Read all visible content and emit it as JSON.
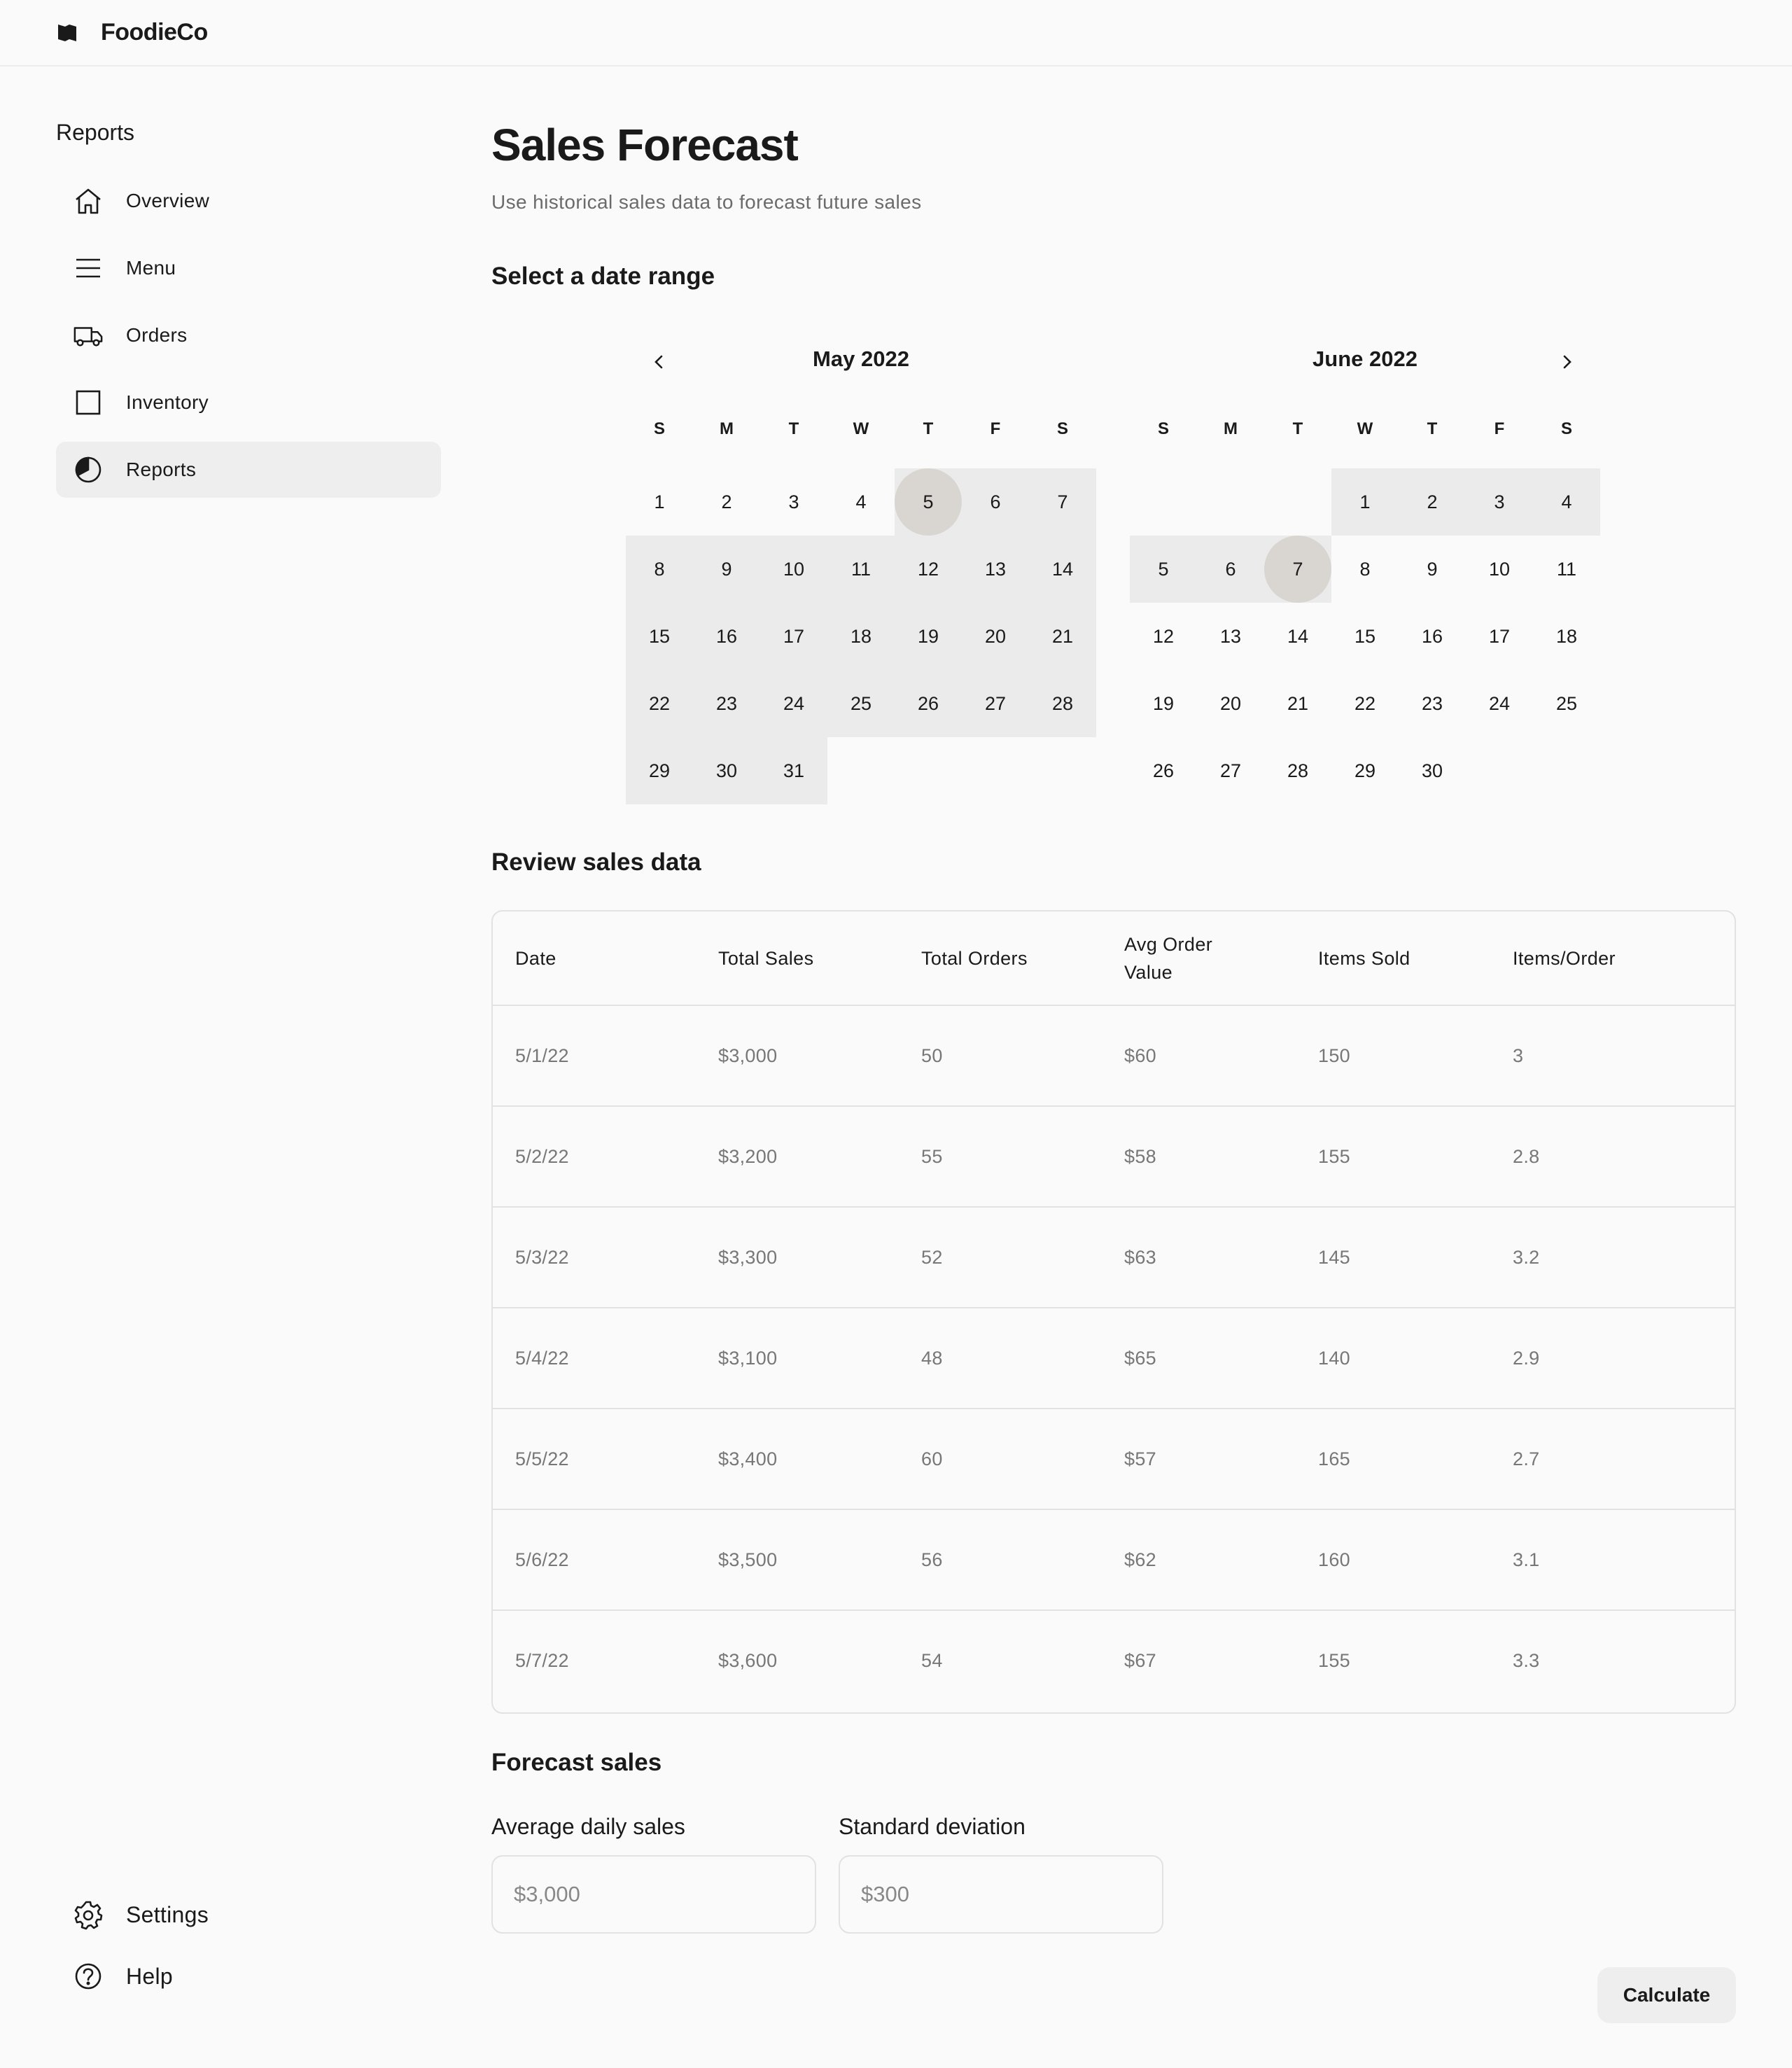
{
  "app": {
    "brand_name": "FoodieCo"
  },
  "sidebar": {
    "heading": "Reports",
    "items": [
      {
        "label": "Overview",
        "icon": "home-icon",
        "active": false
      },
      {
        "label": "Menu",
        "icon": "menu-icon",
        "active": false
      },
      {
        "label": "Orders",
        "icon": "truck-icon",
        "active": false
      },
      {
        "label": "Inventory",
        "icon": "box-icon",
        "active": false
      },
      {
        "label": "Reports",
        "icon": "pie-chart-icon",
        "active": true
      }
    ],
    "bottom_items": [
      {
        "label": "Settings",
        "icon": "gear-icon"
      },
      {
        "label": "Help",
        "icon": "help-icon"
      }
    ]
  },
  "page": {
    "title": "Sales Forecast",
    "subtitle": "Use historical sales data to forecast future sales"
  },
  "date_range": {
    "heading": "Select a date range",
    "weekday_labels": [
      "S",
      "M",
      "T",
      "W",
      "T",
      "F",
      "S"
    ],
    "months": [
      {
        "label": "May 2022",
        "first_weekday": 0,
        "days": 31,
        "range_start": 5,
        "range_end": 31,
        "endpoints": [
          5
        ]
      },
      {
        "label": "June 2022",
        "first_weekday": 3,
        "days": 30,
        "range_start": 1,
        "range_end": 7,
        "endpoints": [
          7
        ]
      }
    ]
  },
  "sales_table": {
    "heading": "Review sales data",
    "columns": [
      "Date",
      "Total Sales",
      "Total Orders",
      "Avg Order Value",
      "Items Sold",
      "Items/Order"
    ],
    "rows": [
      [
        "5/1/22",
        "$3,000",
        "50",
        "$60",
        "150",
        "3"
      ],
      [
        "5/2/22",
        "$3,200",
        "55",
        "$58",
        "155",
        "2.8"
      ],
      [
        "5/3/22",
        "$3,300",
        "52",
        "$63",
        "145",
        "3.2"
      ],
      [
        "5/4/22",
        "$3,100",
        "48",
        "$65",
        "140",
        "2.9"
      ],
      [
        "5/5/22",
        "$3,400",
        "60",
        "$57",
        "165",
        "2.7"
      ],
      [
        "5/6/22",
        "$3,500",
        "56",
        "$62",
        "160",
        "3.1"
      ],
      [
        "5/7/22",
        "$3,600",
        "54",
        "$67",
        "155",
        "3.3"
      ]
    ]
  },
  "forecast": {
    "heading": "Forecast sales",
    "avg_label": "Average daily sales",
    "avg_placeholder": "$3,000",
    "std_label": "Standard deviation",
    "std_placeholder": "$300",
    "calculate_label": "Calculate"
  }
}
